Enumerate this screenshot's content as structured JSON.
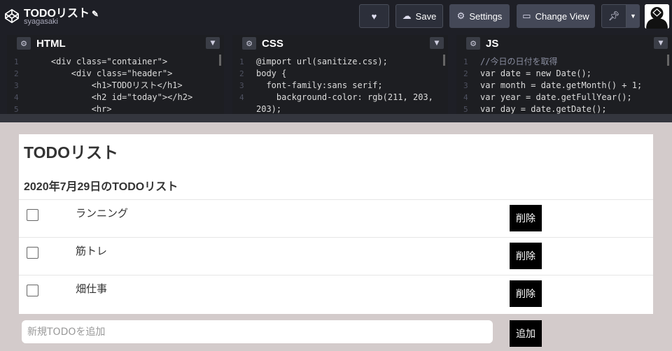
{
  "header": {
    "title": "TODOリスト",
    "author": "syagasaki",
    "buttons": {
      "save": "Save",
      "settings": "Settings",
      "change_view": "Change View"
    }
  },
  "editors": {
    "html": {
      "label": "HTML",
      "lines": [
        {
          "num": "1",
          "code": "    <div class=\"container\">"
        },
        {
          "num": "2",
          "code": "        <div class=\"header\">"
        },
        {
          "num": "3",
          "code": "            <h1>TODOリスト</h1>"
        },
        {
          "num": "4",
          "code": "            <h2 id=\"today\"></h2>"
        },
        {
          "num": "5",
          "code": "            <hr>"
        }
      ]
    },
    "css": {
      "label": "CSS",
      "lines": [
        {
          "num": "1",
          "code": "@import url(sanitize.css);"
        },
        {
          "num": "2",
          "code": "body {"
        },
        {
          "num": "3",
          "code": "  font-family:sans serif;"
        },
        {
          "num": "4",
          "code": "    background-color: rgb(211, 203,"
        },
        {
          "num": "",
          "code": "203);"
        }
      ]
    },
    "js": {
      "label": "JS",
      "lines": [
        {
          "num": "1",
          "code": "//今日の日付を取得"
        },
        {
          "num": "2",
          "code": "var date = new Date();"
        },
        {
          "num": "3",
          "code": "var month = date.getMonth() + 1;"
        },
        {
          "num": "4",
          "code": "var year = date.getFullYear();"
        },
        {
          "num": "5",
          "code": "var day = date.getDate();"
        }
      ]
    }
  },
  "result": {
    "h1": "TODOリスト",
    "h2": "2020年7月29日のTODOリスト",
    "todos": [
      {
        "text": "ランニング",
        "delete_label": "削除"
      },
      {
        "text": "筋トレ",
        "delete_label": "削除"
      },
      {
        "text": "畑仕事",
        "delete_label": "削除"
      }
    ],
    "new_todo": {
      "placeholder": "新規TODOを追加",
      "value": ""
    },
    "add_label": "追加"
  },
  "colors": {
    "topbar": "#1e1f26",
    "result_bg": "#d3cbcb",
    "button_black": "#000000"
  }
}
